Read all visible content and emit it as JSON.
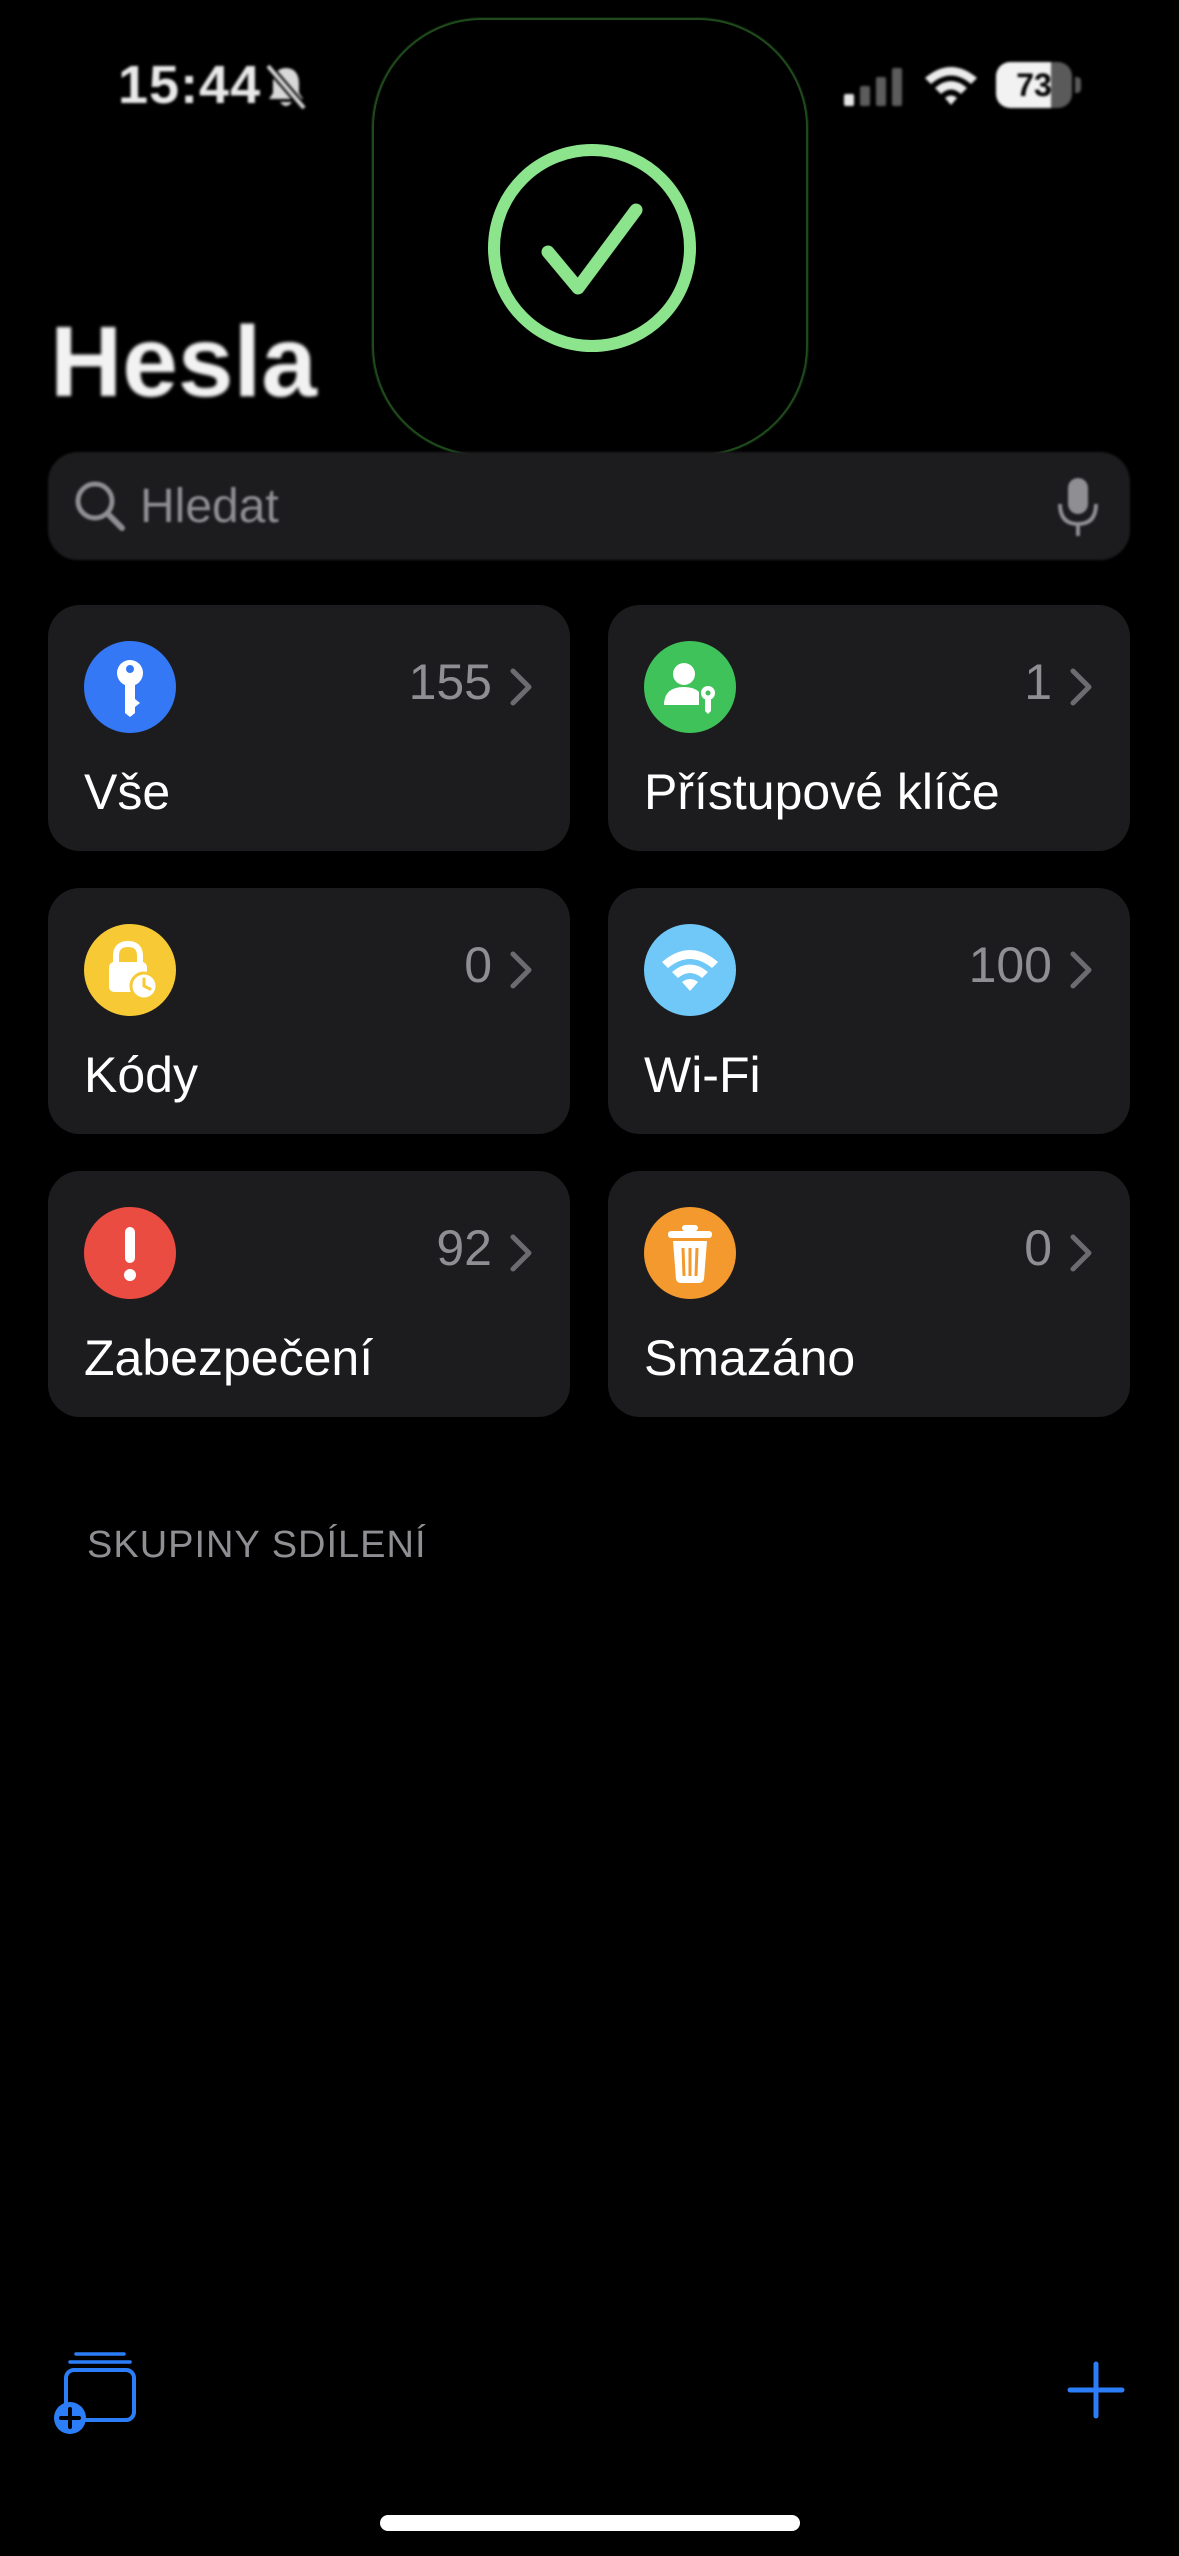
{
  "status_bar": {
    "time": "15:44",
    "battery_percent": "73",
    "battery_level": 0.73,
    "icons": [
      "bell-slash-icon",
      "cellular-signal-icon",
      "wifi-icon",
      "battery-icon"
    ]
  },
  "hud": {
    "icon": "checkmark-circle-icon",
    "color": "#8ce58c"
  },
  "header": {
    "title": "Hesla"
  },
  "search": {
    "placeholder": "Hledat",
    "value": ""
  },
  "tiles": [
    {
      "label": "Vše",
      "count": "155",
      "icon": "key-icon",
      "color": "#3478f6"
    },
    {
      "label": "Přístupové klíče",
      "count": "1",
      "icon": "person-key-icon",
      "color": "#3fc25a"
    },
    {
      "label": "Kódy",
      "count": "0",
      "icon": "lock-clock-icon",
      "color": "#f6c935"
    },
    {
      "label": "Wi-Fi",
      "count": "100",
      "icon": "wifi-icon",
      "color": "#6fc8f7"
    },
    {
      "label": "Zabezpečení",
      "count": "92",
      "icon": "exclamation-icon",
      "color": "#eb4c42"
    },
    {
      "label": "Smazáno",
      "count": "0",
      "icon": "trash-icon",
      "color": "#f3992e"
    }
  ],
  "section": {
    "shared_groups_header": "SKUPINY SDÍLENÍ"
  },
  "toolbar": {
    "accent": "#2c7ef8",
    "new_group_icon": "new-shared-group-icon",
    "add_icon": "plus-icon"
  }
}
